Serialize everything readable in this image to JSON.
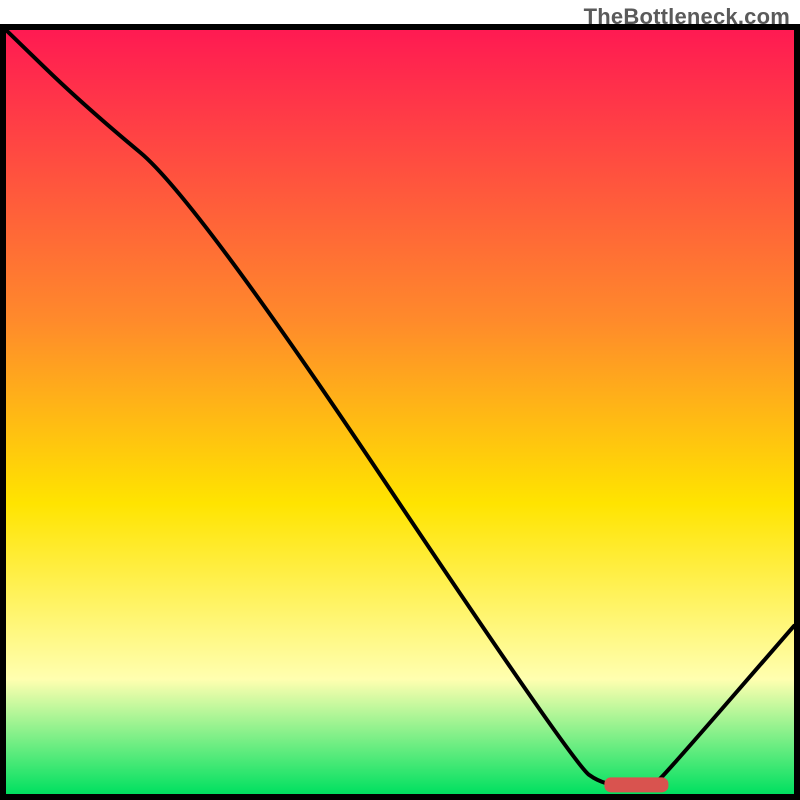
{
  "watermark": "TheBottleneck.com",
  "colors": {
    "line": "#000000",
    "marker_fill": "#d9534f",
    "marker_stroke": "#d9534f",
    "border": "#000000",
    "grad_top": "#ff1a52",
    "grad_mid1": "#ff8a2b",
    "grad_mid2": "#ffe400",
    "grad_mid3": "#ffffb0",
    "grad_bottom": "#00e060"
  },
  "chart_data": {
    "type": "line",
    "title": "",
    "xlabel": "",
    "ylabel": "",
    "xlim": [
      0,
      100
    ],
    "ylim": [
      0,
      100
    ],
    "x": [
      0,
      10,
      24,
      72,
      76,
      82,
      84,
      100
    ],
    "y": [
      100,
      90,
      78,
      4,
      1,
      1,
      3,
      22
    ],
    "marker": {
      "x": [
        76,
        84
      ],
      "y": 1.2
    },
    "gradient_stops": [
      {
        "offset": 0,
        "color": "#ff1a52"
      },
      {
        "offset": 38,
        "color": "#ff8a2b"
      },
      {
        "offset": 62,
        "color": "#ffe400"
      },
      {
        "offset": 85,
        "color": "#ffffb0"
      },
      {
        "offset": 100,
        "color": "#00e060"
      }
    ]
  }
}
